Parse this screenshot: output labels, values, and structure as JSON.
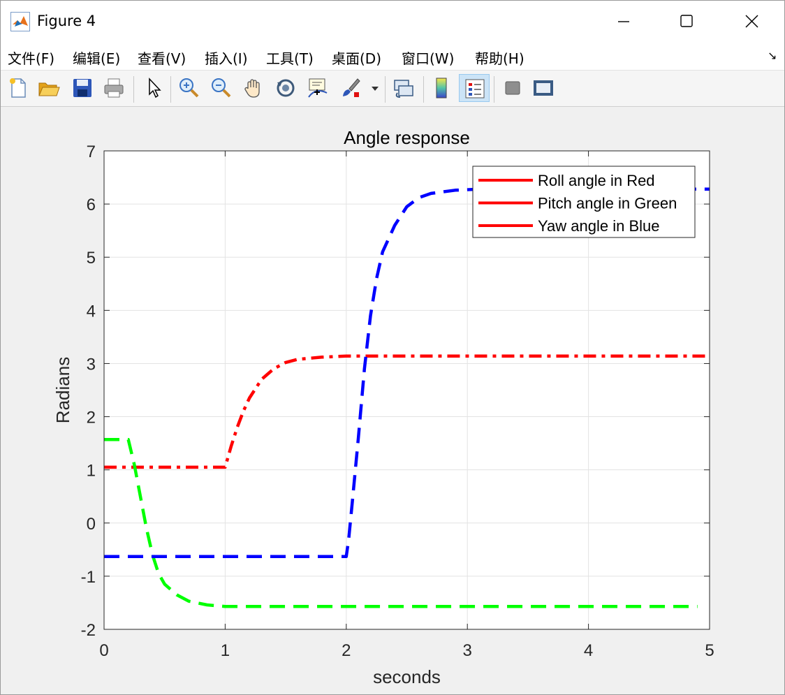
{
  "window": {
    "title": "Figure 4",
    "icon": "matlab-icon",
    "controls": [
      "minimize-icon",
      "maximize-icon",
      "close-icon"
    ]
  },
  "menu": {
    "items": [
      "文件(F)",
      "编辑(E)",
      "查看(V)",
      "插入(I)",
      "工具(T)",
      "桌面(D)",
      "窗口(W)",
      "帮助(H)"
    ],
    "dock_icon": "dock-arrow-icon"
  },
  "toolbar": {
    "buttons": [
      "new-figure-icon",
      "open-file-icon",
      "save-icon",
      "print-icon",
      "edit-plot-arrow-icon",
      "zoom-in-icon",
      "zoom-out-icon",
      "pan-hand-icon",
      "rotate-3d-icon",
      "data-cursor-icon",
      "brush-icon",
      "link-plot-icon",
      "colorbar-icon",
      "legend-icon",
      "hide-plot-tools-icon",
      "show-plot-tools-icon"
    ],
    "active": "legend-icon"
  },
  "colors": {
    "roll": "#ff0000",
    "pitch": "#00ff00",
    "yaw": "#0000ff",
    "legend_line": "#ff0000"
  },
  "chart_data": {
    "type": "line",
    "title": "Angle response",
    "xlabel": "seconds",
    "ylabel": "Radians",
    "xlim": [
      0,
      5
    ],
    "ylim": [
      -2,
      7
    ],
    "xticks": [
      0,
      1,
      2,
      3,
      4,
      5
    ],
    "yticks": [
      -2,
      -1,
      0,
      1,
      2,
      3,
      4,
      5,
      6,
      7
    ],
    "grid": true,
    "legend": {
      "placement": "top-right",
      "entries": [
        "Roll angle in Red",
        "Pitch angle in Green",
        "Yaw angle in Blue"
      ]
    },
    "series": [
      {
        "legend_index": 0,
        "color": "#ff0000",
        "style": "dash-dot",
        "points": [
          [
            0,
            1.05
          ],
          [
            1.0,
            1.05
          ],
          [
            1.05,
            1.45
          ],
          [
            1.1,
            1.8
          ],
          [
            1.15,
            2.1
          ],
          [
            1.2,
            2.35
          ],
          [
            1.3,
            2.7
          ],
          [
            1.4,
            2.9
          ],
          [
            1.5,
            3.02
          ],
          [
            1.6,
            3.08
          ],
          [
            1.8,
            3.12
          ],
          [
            2.0,
            3.14
          ],
          [
            3.0,
            3.14
          ],
          [
            4.0,
            3.14
          ],
          [
            5.0,
            3.14
          ]
        ]
      },
      {
        "legend_index": 1,
        "color": "#00ff00",
        "style": "dashed",
        "points": [
          [
            0,
            1.57
          ],
          [
            0.2,
            1.57
          ],
          [
            0.25,
            1.1
          ],
          [
            0.3,
            0.5
          ],
          [
            0.35,
            -0.1
          ],
          [
            0.4,
            -0.6
          ],
          [
            0.45,
            -0.95
          ],
          [
            0.5,
            -1.15
          ],
          [
            0.6,
            -1.35
          ],
          [
            0.7,
            -1.47
          ],
          [
            0.85,
            -1.54
          ],
          [
            1.0,
            -1.57
          ],
          [
            2.0,
            -1.57
          ],
          [
            3.0,
            -1.57
          ],
          [
            4.0,
            -1.57
          ],
          [
            4.9,
            -1.57
          ]
        ]
      },
      {
        "legend_index": 2,
        "color": "#0000ff",
        "style": "dashed",
        "points": [
          [
            0,
            -0.63
          ],
          [
            1.0,
            -0.63
          ],
          [
            2.0,
            -0.63
          ],
          [
            2.02,
            -0.3
          ],
          [
            2.05,
            0.4
          ],
          [
            2.1,
            1.6
          ],
          [
            2.15,
            2.9
          ],
          [
            2.2,
            3.9
          ],
          [
            2.25,
            4.6
          ],
          [
            2.3,
            5.1
          ],
          [
            2.4,
            5.6
          ],
          [
            2.5,
            5.95
          ],
          [
            2.6,
            6.12
          ],
          [
            2.7,
            6.2
          ],
          [
            2.9,
            6.26
          ],
          [
            3.1,
            6.28
          ],
          [
            4.0,
            6.28
          ],
          [
            5.0,
            6.28
          ]
        ]
      }
    ]
  }
}
